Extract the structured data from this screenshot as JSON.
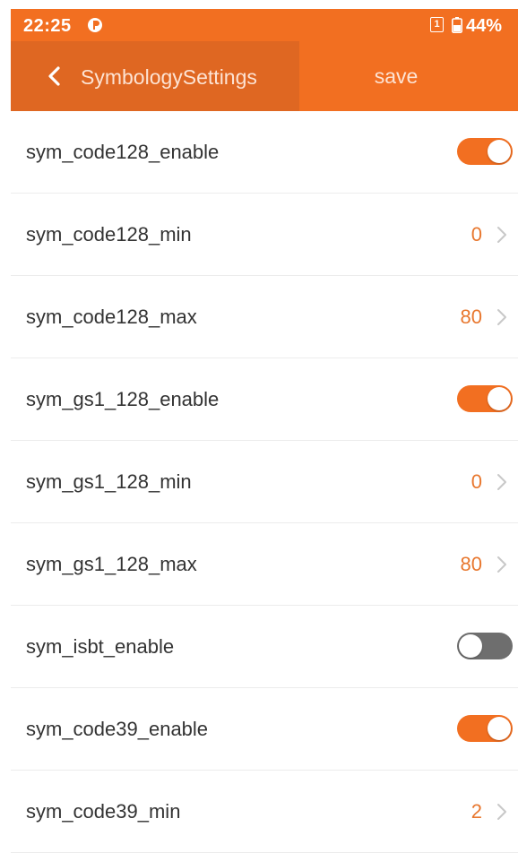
{
  "colors": {
    "accent": "#f26f21",
    "header_back_bg": "#df6722",
    "value_text": "#e8772e",
    "toggle_off": "#6e6e6e"
  },
  "status_bar": {
    "time": "22:25",
    "sim_slot": "1",
    "battery": "44%",
    "app_icon": "notification-app-icon",
    "battery_icon": "battery-icon"
  },
  "header": {
    "back_icon": "chevron-left-icon",
    "title": "SymbologySettings",
    "save_label": "save"
  },
  "settings": [
    {
      "label": "sym_code128_enable",
      "type": "toggle",
      "on": true
    },
    {
      "label": "sym_code128_min",
      "type": "value",
      "value": "0"
    },
    {
      "label": "sym_code128_max",
      "type": "value",
      "value": "80"
    },
    {
      "label": "sym_gs1_128_enable",
      "type": "toggle",
      "on": true
    },
    {
      "label": "sym_gs1_128_min",
      "type": "value",
      "value": "0"
    },
    {
      "label": "sym_gs1_128_max",
      "type": "value",
      "value": "80"
    },
    {
      "label": "sym_isbt_enable",
      "type": "toggle",
      "on": false
    },
    {
      "label": "sym_code39_enable",
      "type": "toggle",
      "on": true
    },
    {
      "label": "sym_code39_min",
      "type": "value",
      "value": "2"
    }
  ]
}
